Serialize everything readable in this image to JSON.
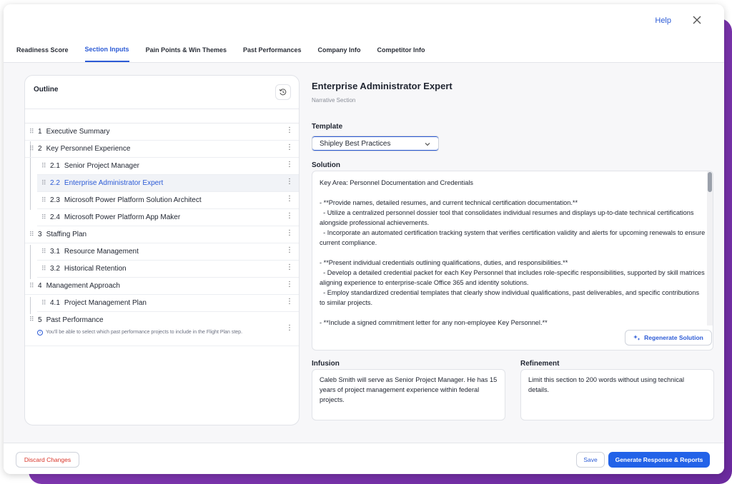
{
  "header": {
    "help_label": "Help",
    "close_icon": "close-icon"
  },
  "tabs": [
    {
      "label": "Readiness Score",
      "active": false
    },
    {
      "label": "Section Inputs",
      "active": true
    },
    {
      "label": "Pain Points & Win Themes",
      "active": false
    },
    {
      "label": "Past Performances",
      "active": false
    },
    {
      "label": "Company Info",
      "active": false
    },
    {
      "label": "Competitor Info",
      "active": false
    }
  ],
  "outline": {
    "title": "Outline",
    "history_icon": "history-icon",
    "items": [
      {
        "num": "1",
        "label": "Executive Summary"
      },
      {
        "num": "2",
        "label": "Key Personnel Experience"
      },
      {
        "num": "2.1",
        "label": "Senior Project Manager"
      },
      {
        "num": "2.2",
        "label": "Enterprise Administrator Expert"
      },
      {
        "num": "2.3",
        "label": "Microsoft Power Platform Solution Architect"
      },
      {
        "num": "2.4",
        "label": "Microsoft Power Platform App Maker"
      },
      {
        "num": "3",
        "label": "Staffing Plan"
      },
      {
        "num": "3.1",
        "label": "Resource Management"
      },
      {
        "num": "3.2",
        "label": "Historical Retention"
      },
      {
        "num": "4",
        "label": "Management Approach"
      },
      {
        "num": "4.1",
        "label": "Project Management Plan"
      },
      {
        "num": "5",
        "label": "Past Performance"
      }
    ],
    "past_performance_note": "You'll be able to select which past performance projects to include in the Flight Plan step."
  },
  "section": {
    "title": "Enterprise Administrator Expert",
    "subtitle": "Narrative Section",
    "template_label": "Template",
    "template_value": "Shipley Best Practices",
    "solution_label": "Solution",
    "solution_text": "Key Area: Personnel Documentation and Credentials\n\n- **Provide names, detailed resumes, and current technical certification documentation.**\n  - Utilize a centralized personnel dossier tool that consolidates individual resumes and displays up-to-date technical certifications alongside professional achievements.\n  - Incorporate an automated certification tracking system that verifies certification validity and alerts for upcoming renewals to ensure current compliance.\n\n- **Present individual credentials outlining qualifications, duties, and responsibilities.**\n  - Develop a detailed credential packet for each Key Personnel that includes role-specific responsibilities, supported by skill matrices aligning experience to enterprise-scale Office 365 and identity solutions.\n  - Employ standardized credential templates that clearly show individual qualifications, past deliverables, and specific contributions to similar projects.\n\n- **Include a signed commitment letter for any non-employee Key Personnel.**",
    "regenerate_label": "Regenerate Solution",
    "infusion_label": "Infusion",
    "infusion_text": "Caleb Smith will serve as Senior Project Manager. He has 15 years of project management experience within federal projects.",
    "refinement_label": "Refinement",
    "refinement_text": "Limit this section to 200 words without using technical details."
  },
  "footer": {
    "discard_label": "Discard Changes",
    "save_label": "Save",
    "generate_label": "Generate Response & Reports"
  },
  "colors": {
    "accent": "#2c5bd6",
    "primary_button": "#2262e8",
    "danger": "#d9362b",
    "backdrop": "#7a35ab"
  }
}
